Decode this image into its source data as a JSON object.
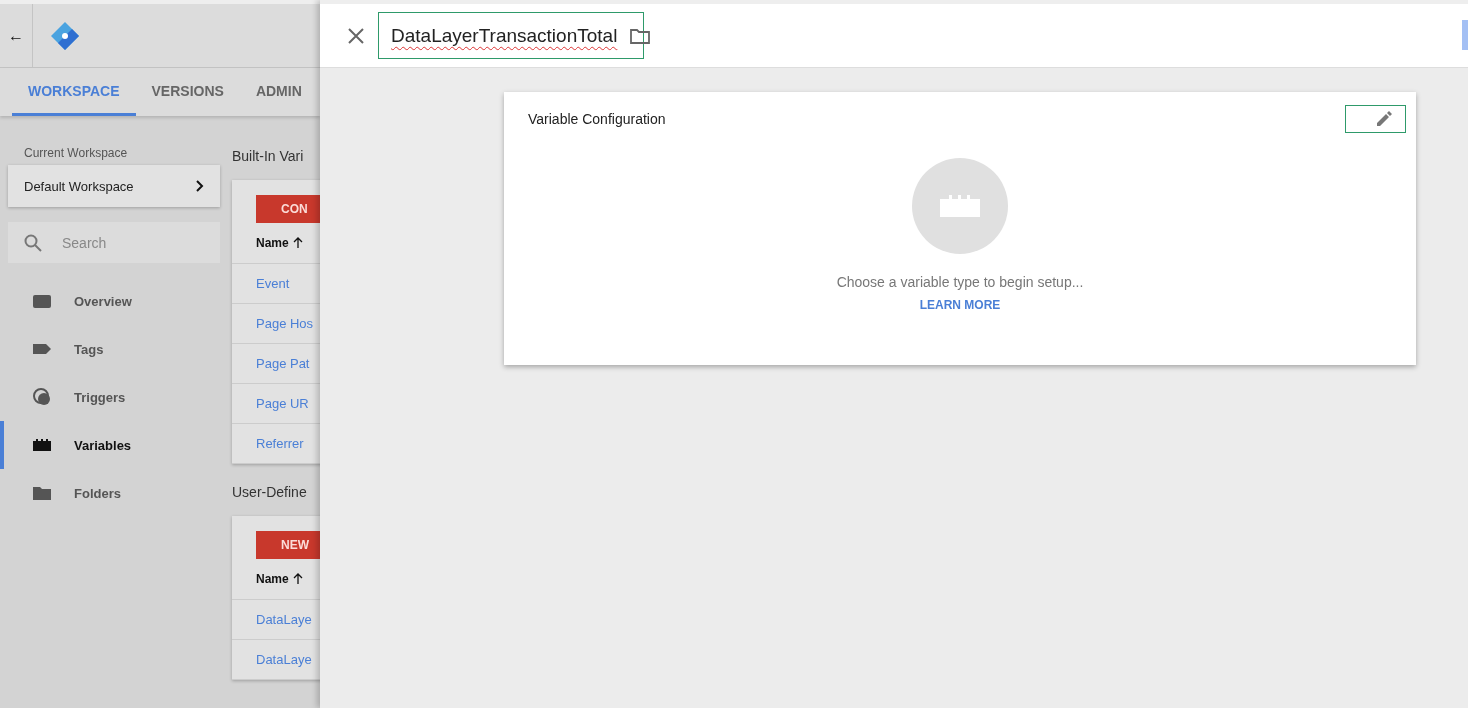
{
  "app_bar": {
    "back": "←"
  },
  "tabs": [
    {
      "label": "WORKSPACE",
      "selected": true
    },
    {
      "label": "VERSIONS",
      "selected": false
    },
    {
      "label": "ADMIN",
      "selected": false
    }
  ],
  "workspace": {
    "caption": "Current Workspace",
    "name": "Default Workspace"
  },
  "search": {
    "placeholder": "Search"
  },
  "sidebar": {
    "items": [
      {
        "label": "Overview",
        "kind": "overview",
        "selected": false
      },
      {
        "label": "Tags",
        "kind": "tags",
        "selected": false
      },
      {
        "label": "Triggers",
        "kind": "triggers",
        "selected": false
      },
      {
        "label": "Variables",
        "kind": "variables",
        "selected": true
      },
      {
        "label": "Folders",
        "kind": "folders",
        "selected": false
      }
    ]
  },
  "sections": [
    {
      "title": "Built-In Vari",
      "button": "CON",
      "column": "Name",
      "rows": [
        "Event",
        "Page Hos",
        "Page Pat",
        "Page UR",
        "Referrer"
      ]
    },
    {
      "title": "User-Define",
      "button": "NEW",
      "column": "Name",
      "rows": [
        "DataLaye",
        "DataLaye"
      ]
    }
  ],
  "editor": {
    "name": "DataLayerTransactionTotal",
    "card_title": "Variable Configuration",
    "hint": "Choose a variable type to begin setup...",
    "link": "LEARN MORE"
  }
}
